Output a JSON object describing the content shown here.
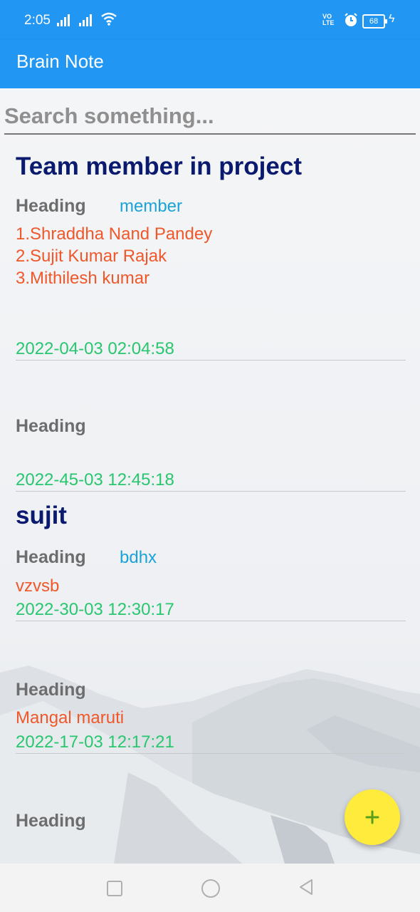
{
  "status": {
    "time": "2:05",
    "volte": "VO\nLTE",
    "battery": "68"
  },
  "app": {
    "title": "Brain Note"
  },
  "search": {
    "placeholder": "Search something..."
  },
  "notes": [
    {
      "title": "Team member in project",
      "heading": "Heading",
      "tag": "member",
      "body": "1.Shraddha Nand Pandey\n2.Sujit Kumar Rajak\n3.Mithilesh kumar",
      "date": "2022-04-03 02:04:58"
    },
    {
      "title": "",
      "heading": "Heading",
      "tag": "",
      "body": "",
      "date": "2022-45-03 12:45:18"
    },
    {
      "title": "sujit",
      "heading": "Heading",
      "tag": "bdhx",
      "body": "vzvsb",
      "date": "2022-30-03 12:30:17"
    },
    {
      "title": "",
      "heading": "Heading",
      "tag": "",
      "body": "Mangal maruti",
      "date": "2022-17-03 12:17:21"
    },
    {
      "title": "",
      "heading": "Heading",
      "tag": "",
      "body": "",
      "date": ""
    }
  ],
  "fab": {
    "icon": "plus-icon",
    "color": "#ffeb3b"
  },
  "colors": {
    "primary": "#2196f3",
    "title": "#0a1a6e",
    "tag": "#1aa3d8",
    "body": "#f0572a",
    "date": "#28c76f"
  }
}
